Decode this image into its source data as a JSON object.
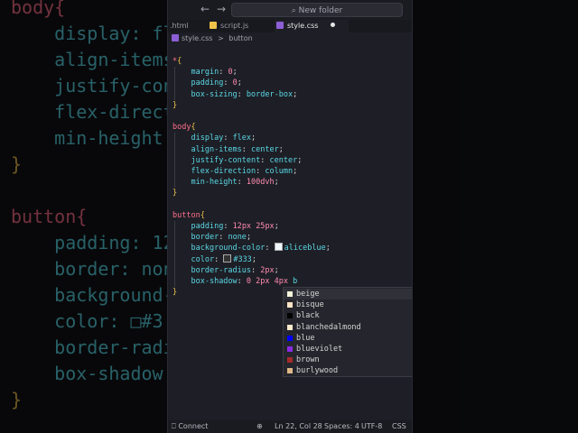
{
  "background_code": {
    "lines": [
      {
        "text": "body{",
        "kind": "selector"
      },
      {
        "text": "    display: fl",
        "kind": "decl"
      },
      {
        "text": "    align-items",
        "kind": "decl"
      },
      {
        "text": "    justify-cont",
        "kind": "decl"
      },
      {
        "text": "    flex-direct",
        "kind": "decl"
      },
      {
        "text": "    min-height:",
        "kind": "decl"
      },
      {
        "text": "}",
        "kind": "brace"
      },
      {
        "text": "",
        "kind": "blank"
      },
      {
        "text": "button{",
        "kind": "selector"
      },
      {
        "text": "    padding: 12",
        "kind": "decl"
      },
      {
        "text": "    border: non",
        "kind": "decl"
      },
      {
        "text": "    background-",
        "kind": "decl"
      },
      {
        "text": "    color: □#3",
        "kind": "decl"
      },
      {
        "text": "    border-radi",
        "kind": "decl"
      },
      {
        "text": "    box-shadow:",
        "kind": "decl"
      },
      {
        "text": "}",
        "kind": "brace"
      }
    ]
  },
  "titlebar": {
    "search_placeholder": "New folder",
    "back_icon": "arrow-left-icon",
    "forward_icon": "arrow-right-icon"
  },
  "tabs": [
    {
      "label": ".html",
      "icon": "html-file-icon",
      "color": "#e8743b"
    },
    {
      "label": "script.js",
      "icon": "js-file-icon",
      "color": "#f0c24a"
    },
    {
      "label": "style.css",
      "icon": "css-file-icon",
      "color": "#8c5fd6",
      "active": true
    }
  ],
  "breadcrumb": {
    "file": "style.css",
    "separator": ">",
    "symbol": "button"
  },
  "editor": {
    "lines": [
      [
        "*{"
      ],
      [
        "    margin: 0;"
      ],
      [
        "    padding: 0;"
      ],
      [
        "    box-sizing: border-box;"
      ],
      [
        "}"
      ],
      [
        ""
      ],
      [
        "body{"
      ],
      [
        "    display: flex;"
      ],
      [
        "    align-items: center;"
      ],
      [
        "    justify-content: center;"
      ],
      [
        "    flex-direction: column;"
      ],
      [
        "    min-height: 100dvh;"
      ],
      [
        "}"
      ],
      [
        ""
      ],
      [
        "button{"
      ],
      [
        "    padding: 12px 25px;"
      ],
      [
        "    border: none;"
      ],
      [
        "    background-color: aliceblue;"
      ],
      [
        "    color: #333;"
      ],
      [
        "    border-radius: 2px;"
      ],
      [
        "    box-shadow: 0 2px 4px b"
      ],
      [
        "}"
      ]
    ]
  },
  "autocomplete": {
    "items": [
      {
        "label": "beige",
        "color": "#f5f5dc"
      },
      {
        "label": "bisque",
        "color": "#ffe4c4"
      },
      {
        "label": "black",
        "color": "#000000"
      },
      {
        "label": "blanchedalmond",
        "color": "#ffebcd"
      },
      {
        "label": "blue",
        "color": "#0000ff"
      },
      {
        "label": "blueviolet",
        "color": "#8a2be2"
      },
      {
        "label": "brown",
        "color": "#a52a2a"
      },
      {
        "label": "burlywood",
        "color": "#deb887"
      }
    ]
  },
  "statusbar": {
    "connect": "Connect",
    "position": "Ln 22, Col 28",
    "spaces": "Spaces: 4",
    "encoding": "UTF-8",
    "language": "CSS"
  }
}
